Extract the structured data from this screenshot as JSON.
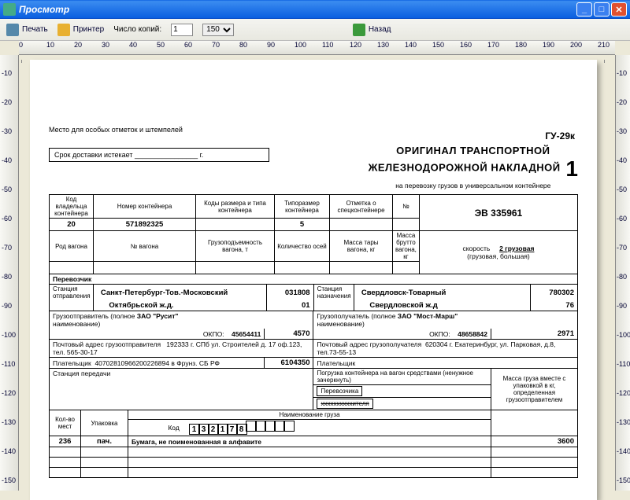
{
  "window": {
    "title": "Просмотр"
  },
  "toolbar": {
    "print": "Печать",
    "printer": "Принтер",
    "copies_label": "Число копий:",
    "copies_value": "1",
    "zoom": "150 %",
    "back": "Назад"
  },
  "ruler_h": [
    "0",
    "10",
    "20",
    "30",
    "40",
    "50",
    "60",
    "70",
    "80",
    "90",
    "100",
    "110",
    "120",
    "130",
    "140",
    "150",
    "160",
    "170",
    "180",
    "190",
    "200",
    "210"
  ],
  "ruler_v": [
    "-10",
    "-20",
    "-30",
    "-40",
    "-50",
    "-60",
    "-70",
    "-80",
    "-90",
    "-100",
    "-110",
    "-120",
    "-130",
    "-140",
    "-150"
  ],
  "doc": {
    "form_code": "ГУ-29к",
    "marks_place": "Место для особых отметок и штемпелей",
    "title1": "ОРИГИНАЛ ТРАНСПОРТНОЙ",
    "title2": "ЖЕЛЕЗНОДОРОЖНОЙ НАКЛАДНОЙ",
    "title_num": "1",
    "subtitle": "на перевозку грузов в универсальном контейнере",
    "deadline_lbl": "Срок доставки истекает",
    "deadline_unit": "г.",
    "hdr_owner_code": "Код владельца контейнера",
    "hdr_cont_no": "Номер контейнера",
    "hdr_size_codes": "Коды размера и типа контейнера",
    "hdr_size": "Типоразмер контейнера",
    "hdr_spec": "Отметка о спецконтейнере",
    "hdr_no": "№",
    "val_owner_code": "20",
    "val_cont_no": "571892325",
    "val_size": "5",
    "val_serial": "ЭВ 335961",
    "hdr_wagon_kind": "Род вагона",
    "hdr_wagon_no": "№ вагона",
    "hdr_load_cap": "Грузоподъемность вагона, т",
    "hdr_axles": "Количество осей",
    "hdr_tare": "Масса тары вагона, кг",
    "hdr_gross": "Масса брутто вагона, кг",
    "speed_lbl": "скорость",
    "speed_val": "2 грузовая",
    "speed_note": "(грузовая, большая)",
    "carrier": "Перевозчик",
    "dep_station_lbl": "Станция отправления",
    "dep_station": "Санкт-Петербург-Тов.-Московский",
    "dep_code": "031808",
    "dest_station_lbl": "Станция назначения",
    "dest_station": "Свердловск-Товарный",
    "dest_code": "780302",
    "dep_railway": "Октябрьской ж.д.",
    "dep_railway_code": "01",
    "dest_railway": "Свердловской ж.д",
    "dest_railway_code": "76",
    "shipper_lbl": "Грузоотправитель (полное",
    "shipper_name": "ЗАО \"Русит\"",
    "shipper_sub": "наименование)",
    "shipper_okpo_lbl": "ОКПО:",
    "shipper_okpo": "45654411",
    "shipper_code": "4570",
    "consignee_lbl": "Грузополучатель (полное",
    "consignee_name": "ЗАО \"Мост-Марш\"",
    "consignee_sub": "наименование)",
    "consignee_okpo_lbl": "ОКПО:",
    "consignee_okpo": "48658842",
    "consignee_code": "2971",
    "shipper_addr_lbl": "Почтовый адрес грузоотправителя",
    "shipper_addr": "192333 г. СПб ул. Строителей д. 17 оф.123, тел. 565-30-17",
    "consignee_addr_lbl": "Почтовый адрес грузополучателя",
    "consignee_addr": "620304 г. Екатеринбург, ул. Парковая, д.8, тел.73-55-13",
    "payer_lbl": "Плательщик",
    "payer_name": "40702810966200226894 в Фрунз. СБ РФ",
    "payer_code": "6104350",
    "payer2_lbl": "Плательщик",
    "transfer_station_lbl": "Станция передачи",
    "loading_lbl": "Погрузка контейнера на вагон средствами (ненужное зачеркнуть)",
    "loader1": "Перевозчика",
    "loader2": "xxxxxxxxxxителя",
    "mass_box": "Масса груза вместе с упаковкой в кг, определенная грузоотправителем",
    "col_qty": "Кол-во мест",
    "col_pack": "Упаковка",
    "col_name": "Наименование груза",
    "code_lbl": "Код",
    "code_digits": [
      "1",
      "3",
      "2",
      "1",
      "7",
      "8",
      "",
      "",
      "",
      "",
      ""
    ],
    "cargo_qty": "236",
    "cargo_pack": "пач.",
    "cargo_name": "Бумага, не поименованная в алфавите",
    "cargo_mass": "3600"
  }
}
